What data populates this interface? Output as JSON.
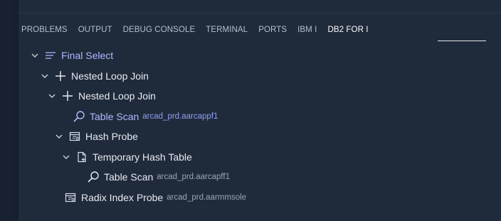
{
  "panel": {
    "tabs": [
      {
        "label": "PROBLEMS"
      },
      {
        "label": "OUTPUT"
      },
      {
        "label": "DEBUG CONSOLE"
      },
      {
        "label": "TERMINAL"
      },
      {
        "label": "PORTS"
      },
      {
        "label": "IBM I"
      },
      {
        "label": "DB2 FOR I",
        "active": true
      }
    ]
  },
  "tree": {
    "nodes": [
      {
        "label": "Final Select",
        "icon": "list-icon",
        "expanded": true
      },
      {
        "label": "Nested Loop Join",
        "icon": "plus-icon",
        "expanded": true
      },
      {
        "label": "Nested Loop Join",
        "icon": "plus-icon",
        "expanded": true
      },
      {
        "label": "Table Scan",
        "detail": "arcad_prd.aarcappf1",
        "icon": "search-icon"
      },
      {
        "label": "Hash Probe",
        "icon": "hash-probe-icon",
        "expanded": true
      },
      {
        "label": "Temporary Hash Table",
        "icon": "temp-file-icon",
        "expanded": true
      },
      {
        "label": "Table Scan",
        "detail": "arcad_prd.aarcapff1",
        "icon": "search-icon"
      },
      {
        "label": "Radix Index Probe",
        "detail": "arcad_prd.aarmmsole",
        "icon": "index-probe-icon"
      }
    ]
  },
  "colors": {
    "panel_bg": "#1f2a3b",
    "accent_text": "#aebaff"
  }
}
